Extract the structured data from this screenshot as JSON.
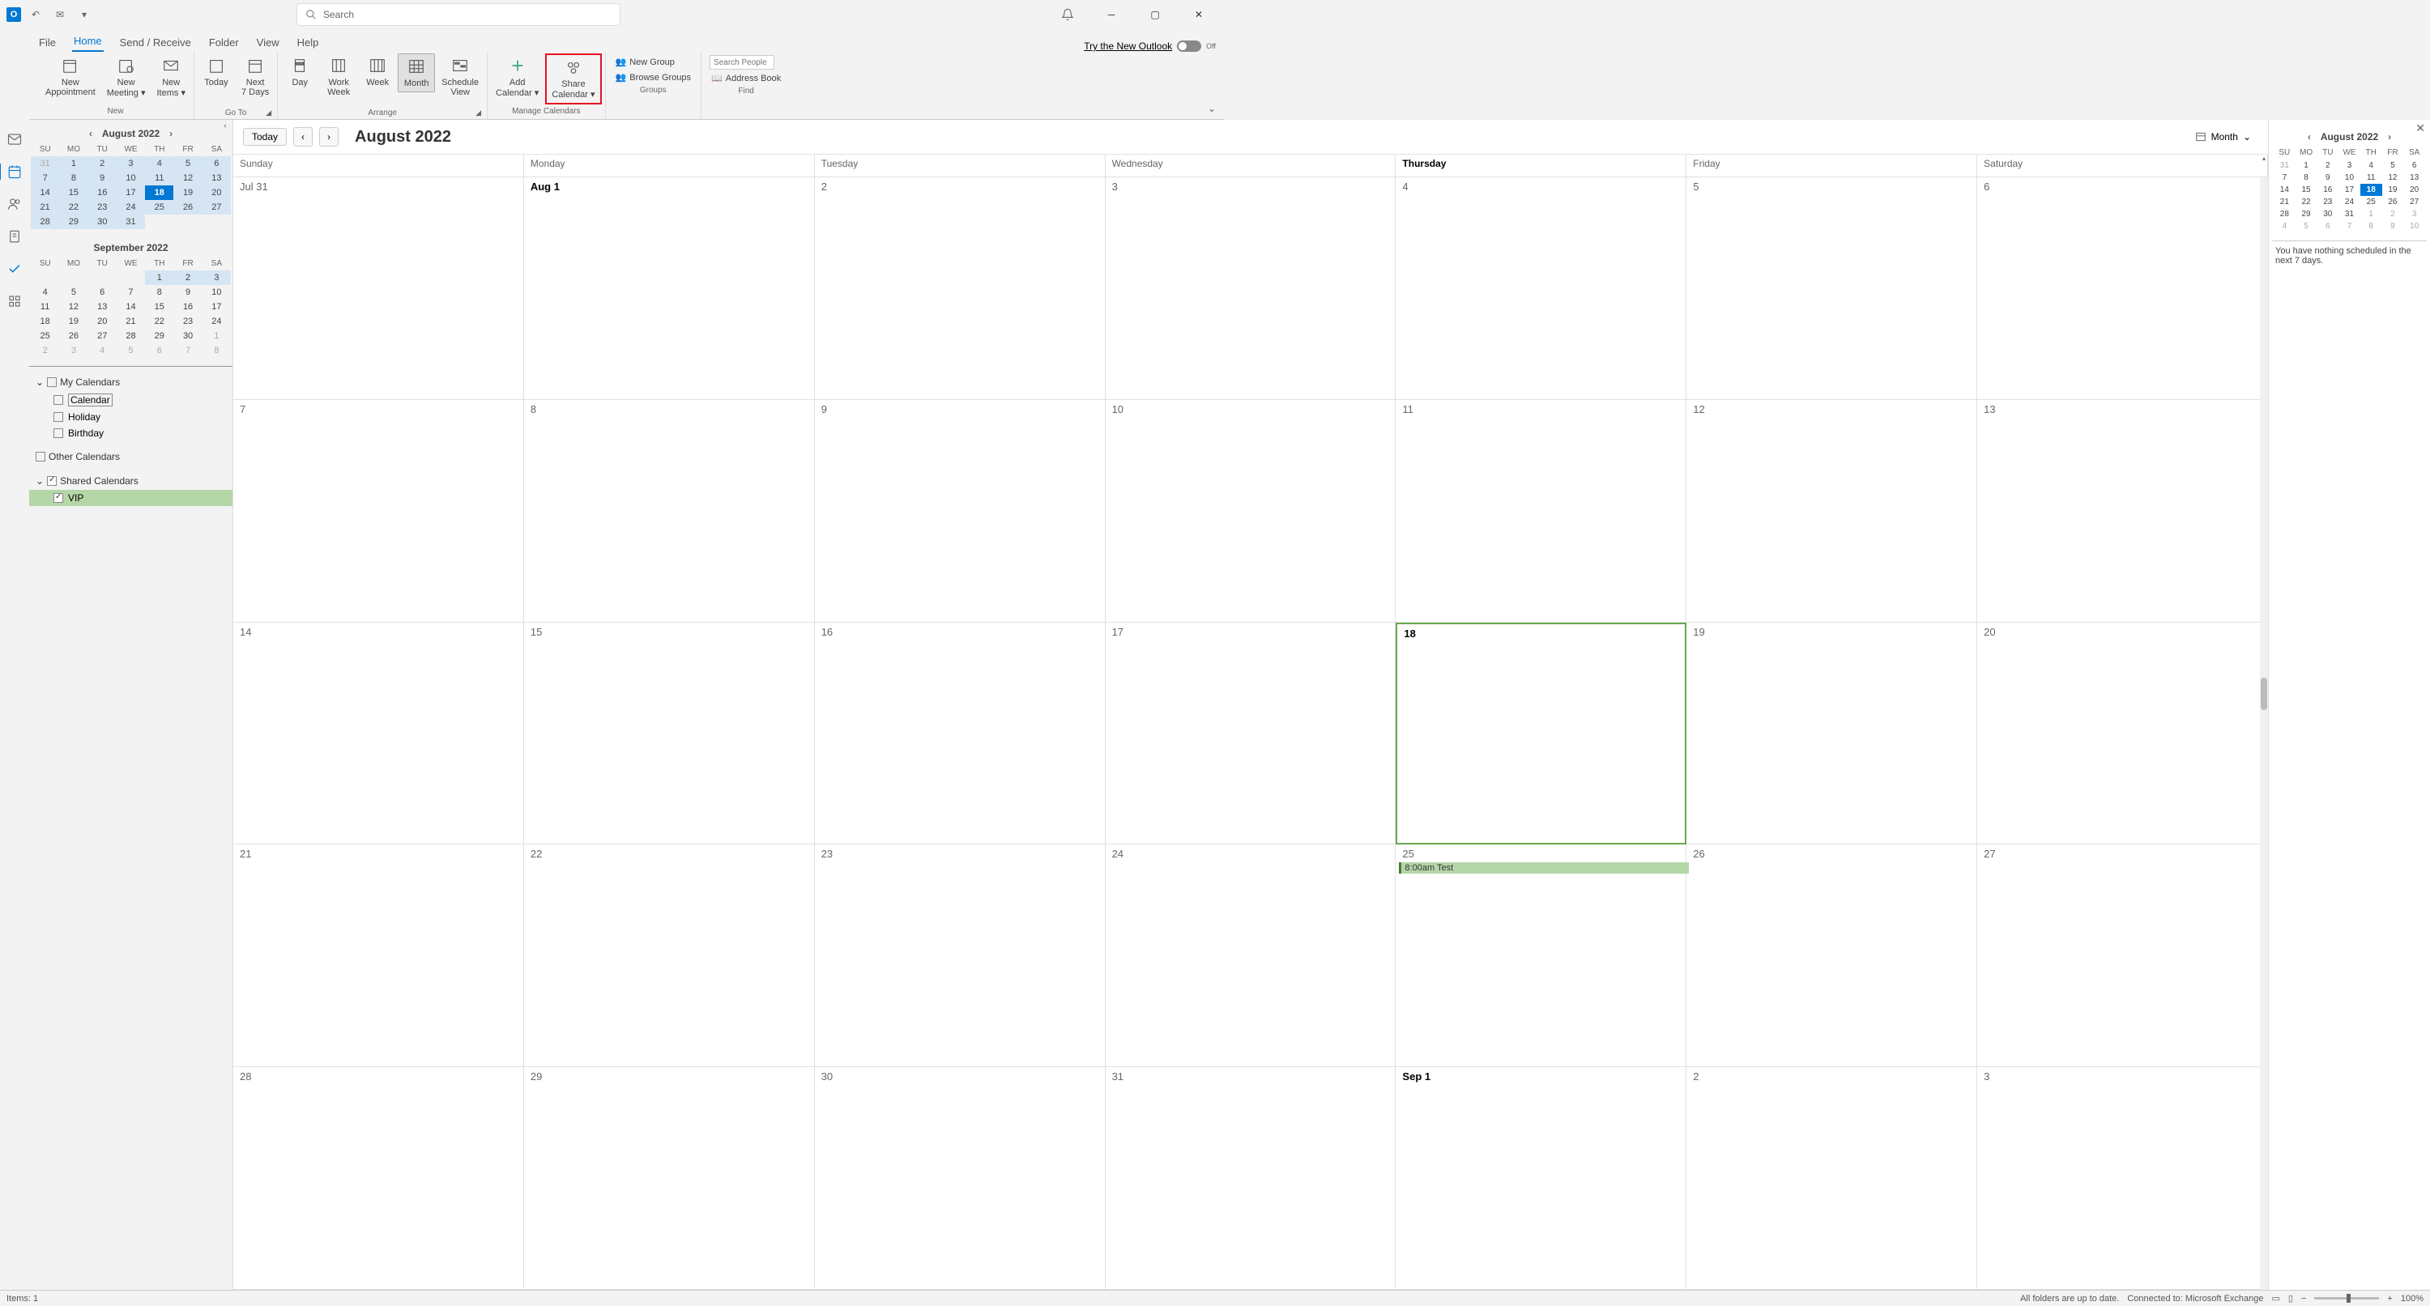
{
  "title_bar": {
    "app": "O",
    "search_placeholder": "Search"
  },
  "tabs": {
    "items": [
      "File",
      "Home",
      "Send / Receive",
      "Folder",
      "View",
      "Help"
    ],
    "try_new": "Try the New Outlook",
    "toggle_off": "Off"
  },
  "ribbon": {
    "new_appointment": "New\nAppointment",
    "new_meeting": "New\nMeeting",
    "new_items": "New\nItems",
    "new_label": "New",
    "today": "Today",
    "next7": "Next\n7 Days",
    "goto_label": "Go To",
    "day": "Day",
    "work_week": "Work\nWeek",
    "week": "Week",
    "month": "Month",
    "schedule_view": "Schedule\nView",
    "arrange_label": "Arrange",
    "add_calendar": "Add\nCalendar",
    "share_calendar": "Share\nCalendar",
    "manage_label": "Manage Calendars",
    "new_group": "New Group",
    "browse_groups": "Browse Groups",
    "groups_label": "Groups",
    "search_people": "Search People",
    "address_book": "Address Book",
    "find_label": "Find"
  },
  "left_panel": {
    "month1": "August 2022",
    "month2": "September 2022",
    "dow": [
      "SU",
      "MO",
      "TU",
      "WE",
      "TH",
      "FR",
      "SA"
    ],
    "aug_days": [
      [
        "31",
        "1",
        "2",
        "3",
        "4",
        "5",
        "6"
      ],
      [
        "7",
        "8",
        "9",
        "10",
        "11",
        "12",
        "13"
      ],
      [
        "14",
        "15",
        "16",
        "17",
        "18",
        "19",
        "20"
      ],
      [
        "21",
        "22",
        "23",
        "24",
        "25",
        "26",
        "27"
      ],
      [
        "28",
        "29",
        "30",
        "31",
        "",
        "",
        ""
      ]
    ],
    "sep_days": [
      [
        "",
        "",
        "",
        "1",
        "2",
        "3",
        ""
      ],
      [
        "4",
        "5",
        "6",
        "7",
        "8",
        "9",
        "10"
      ],
      [
        "11",
        "12",
        "13",
        "14",
        "15",
        "16",
        "17"
      ],
      [
        "18",
        "19",
        "20",
        "21",
        "22",
        "23",
        "24"
      ],
      [
        "25",
        "26",
        "27",
        "28",
        "29",
        "30",
        "1"
      ],
      [
        "2",
        "3",
        "4",
        "5",
        "6",
        "7",
        "8"
      ]
    ],
    "my_calendars": "My Calendars",
    "calendar": "Calendar",
    "holiday": "Holiday",
    "birthday": "Birthday",
    "other_calendars": "Other Calendars",
    "shared_calendars": "Shared Calendars",
    "vip": "VIP"
  },
  "calendar": {
    "today": "Today",
    "title": "August 2022",
    "view": "Month",
    "dow": [
      "Sunday",
      "Monday",
      "Tuesday",
      "Wednesday",
      "Thursday",
      "Friday",
      "Saturday"
    ],
    "cells": [
      [
        "Jul 31",
        "Aug 1",
        "2",
        "3",
        "4",
        "5",
        "6"
      ],
      [
        "7",
        "8",
        "9",
        "10",
        "11",
        "12",
        "13"
      ],
      [
        "14",
        "15",
        "16",
        "17",
        "18",
        "19",
        "20"
      ],
      [
        "21",
        "22",
        "23",
        "24",
        "25",
        "26",
        "27"
      ],
      [
        "28",
        "29",
        "30",
        "31",
        "Sep 1",
        "2",
        "3"
      ]
    ],
    "event_text": "8:00am Test"
  },
  "right_panel": {
    "month": "August 2022",
    "dow": [
      "SU",
      "MO",
      "TU",
      "WE",
      "TH",
      "FR",
      "SA"
    ],
    "days": [
      [
        "31",
        "1",
        "2",
        "3",
        "4",
        "5",
        "6"
      ],
      [
        "7",
        "8",
        "9",
        "10",
        "11",
        "12",
        "13"
      ],
      [
        "14",
        "15",
        "16",
        "17",
        "18",
        "19",
        "20"
      ],
      [
        "21",
        "22",
        "23",
        "24",
        "25",
        "26",
        "27"
      ],
      [
        "28",
        "29",
        "30",
        "31",
        "1",
        "2",
        "3"
      ],
      [
        "4",
        "5",
        "6",
        "7",
        "8",
        "9",
        "10"
      ]
    ],
    "schedule_msg": "You have nothing scheduled in the next 7 days."
  },
  "status_bar": {
    "items": "Items: 1",
    "folders": "All folders are up to date.",
    "connected": "Connected to: Microsoft Exchange",
    "zoom": "100%"
  }
}
